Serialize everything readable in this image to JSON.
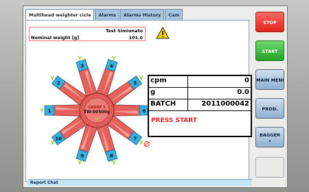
{
  "tabs": [
    {
      "label": "Multihead weighter cicle",
      "active": true
    },
    {
      "label": "Alarms",
      "active": false
    },
    {
      "label": "Alarms History",
      "active": false
    },
    {
      "label": "Cam",
      "active": false
    }
  ],
  "product": {
    "name": "Test Simionato",
    "nominal_label": "Nominal weight [g]",
    "nominal_value": "101.0"
  },
  "weigher": {
    "center_line1": "GROUP 1",
    "center_line2": "TW:00500g",
    "heads": [
      "1",
      "2",
      "3",
      "4",
      "5",
      "6",
      "7",
      "8",
      "9",
      "10"
    ]
  },
  "stats": {
    "cpm_label": "cpm",
    "cpm_value": "0",
    "g_label": "g",
    "g_value": "0.0",
    "batch_label": "BATCH",
    "batch_value": "2011000042",
    "status": "PRESS START"
  },
  "report_label": "Report Chat",
  "side_buttons": {
    "stop": "STOP",
    "start": "START",
    "main_menu": "MAIN MENU",
    "prod": "PROD.",
    "bagger": "BAGGER"
  },
  "colors": {
    "stop": "#e0241c",
    "start": "#22a322",
    "status_text": "#e0202a",
    "bucket": "#e6615a",
    "highlight": "#8fd42a"
  }
}
